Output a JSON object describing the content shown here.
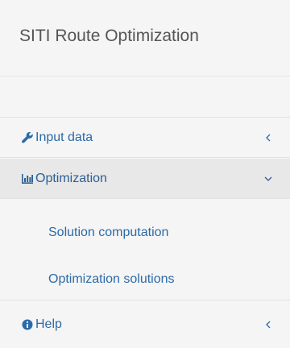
{
  "brand": {
    "title": "SITI Route Optimization"
  },
  "nav": {
    "items": [
      {
        "label": "Input data",
        "icon": "wrench-icon",
        "state": "collapsed"
      },
      {
        "label": "Optimization",
        "icon": "bar-chart-icon",
        "state": "expanded",
        "children": [
          {
            "label": "Solution computation"
          },
          {
            "label": "Optimization solutions"
          }
        ]
      },
      {
        "label": "Help",
        "icon": "info-circle-icon",
        "state": "collapsed"
      }
    ]
  },
  "colors": {
    "link": "#2c6aa8",
    "background": "#f5f5f5",
    "active_background": "#e8e8e8",
    "brand_text": "#555555"
  }
}
